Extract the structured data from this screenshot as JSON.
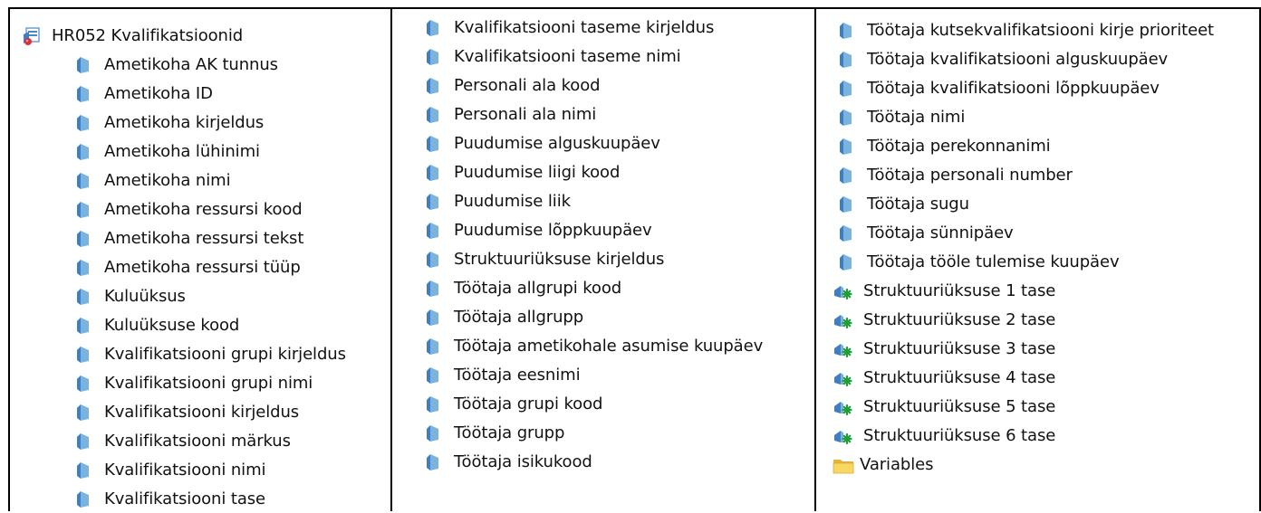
{
  "tree": {
    "col1": {
      "root_label": "HR052 Kvalifikatsioonid",
      "items": [
        "Ametikoha AK tunnus",
        "Ametikoha ID",
        "Ametikoha kirjeldus",
        "Ametikoha lühinimi",
        "Ametikoha nimi",
        "Ametikoha ressursi kood",
        "Ametikoha ressursi tekst",
        "Ametikoha ressursi tüüp",
        "Kuluüksus",
        "Kuluüksuse kood",
        "Kvalifikatsiooni grupi kirjeldus",
        "Kvalifikatsiooni grupi nimi",
        "Kvalifikatsiooni kirjeldus",
        "Kvalifikatsiooni märkus",
        "Kvalifikatsiooni nimi",
        "Kvalifikatsiooni tase"
      ]
    },
    "col2": {
      "items": [
        "Kvalifikatsiooni taseme kirjeldus",
        "Kvalifikatsiooni taseme nimi",
        "Personali ala kood",
        "Personali ala nimi",
        "Puudumise alguskuupäev",
        "Puudumise liigi kood",
        "Puudumise liik",
        "Puudumise lõppkuupäev",
        "Struktuuriüksuse kirjeldus",
        "Töötaja allgrupi kood",
        "Töötaja allgrupp",
        "Töötaja ametikohale asumise kuupäev",
        "Töötaja eesnimi",
        "Töötaja grupi kood",
        "Töötaja grupp",
        "Töötaja isikukood"
      ]
    },
    "col3": {
      "items": [
        "Töötaja kutsekvalifikatsiooni kirje prioriteet",
        "Töötaja kvalifikatsiooni alguskuupäev",
        "Töötaja kvalifikatsiooni lõppkuupäev",
        "Töötaja nimi",
        "Töötaja perekonnanimi",
        "Töötaja personali number",
        "Töötaja sugu",
        "Töötaja sünnipäev",
        "Töötaja tööle tulemise kuupäev"
      ],
      "hierarchy_items": [
        "Struktuuriüksuse 1 tase",
        "Struktuuriüksuse 2 tase",
        "Struktuuriüksuse 3 tase",
        "Struktuuriüksuse 4 tase",
        "Struktuuriüksuse 5 tase",
        "Struktuuriüksuse 6 tase"
      ],
      "folder_label": "Variables"
    }
  },
  "icons": {
    "root": "universe-icon",
    "item": "dimension-object-icon",
    "hierarchy": "hierarchy-level-icon",
    "folder": "folder-icon"
  },
  "colors": {
    "dimension_blue": "#5b9bd5",
    "hierarchy_green": "#1f9d3a",
    "folder_yellow": "#f3c84b"
  }
}
